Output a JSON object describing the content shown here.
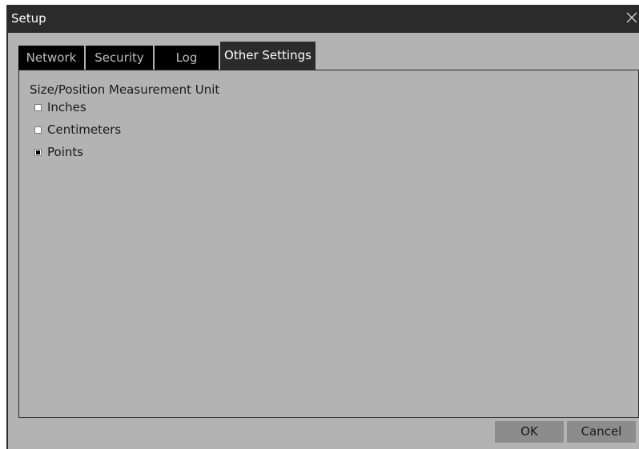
{
  "window": {
    "title": "Setup"
  },
  "tabs": [
    {
      "label": "Network",
      "active": false
    },
    {
      "label": "Security",
      "active": false
    },
    {
      "label": "Log",
      "active": false
    },
    {
      "label": "Other Settings",
      "active": true
    }
  ],
  "measurement_unit": {
    "group_label": "Size/Position Measurement Unit",
    "options": [
      {
        "label": "Inches",
        "checked": false
      },
      {
        "label": "Centimeters",
        "checked": false
      },
      {
        "label": "Points",
        "checked": true
      }
    ]
  },
  "buttons": {
    "ok_label": "OK",
    "cancel_label": "Cancel"
  },
  "colors": {
    "titlebar": "#2b2b2b",
    "background": "#b3b3b3",
    "inactive_tab": "#000000",
    "button": "#8c8c8c"
  },
  "icons": {
    "close": "close-icon"
  }
}
